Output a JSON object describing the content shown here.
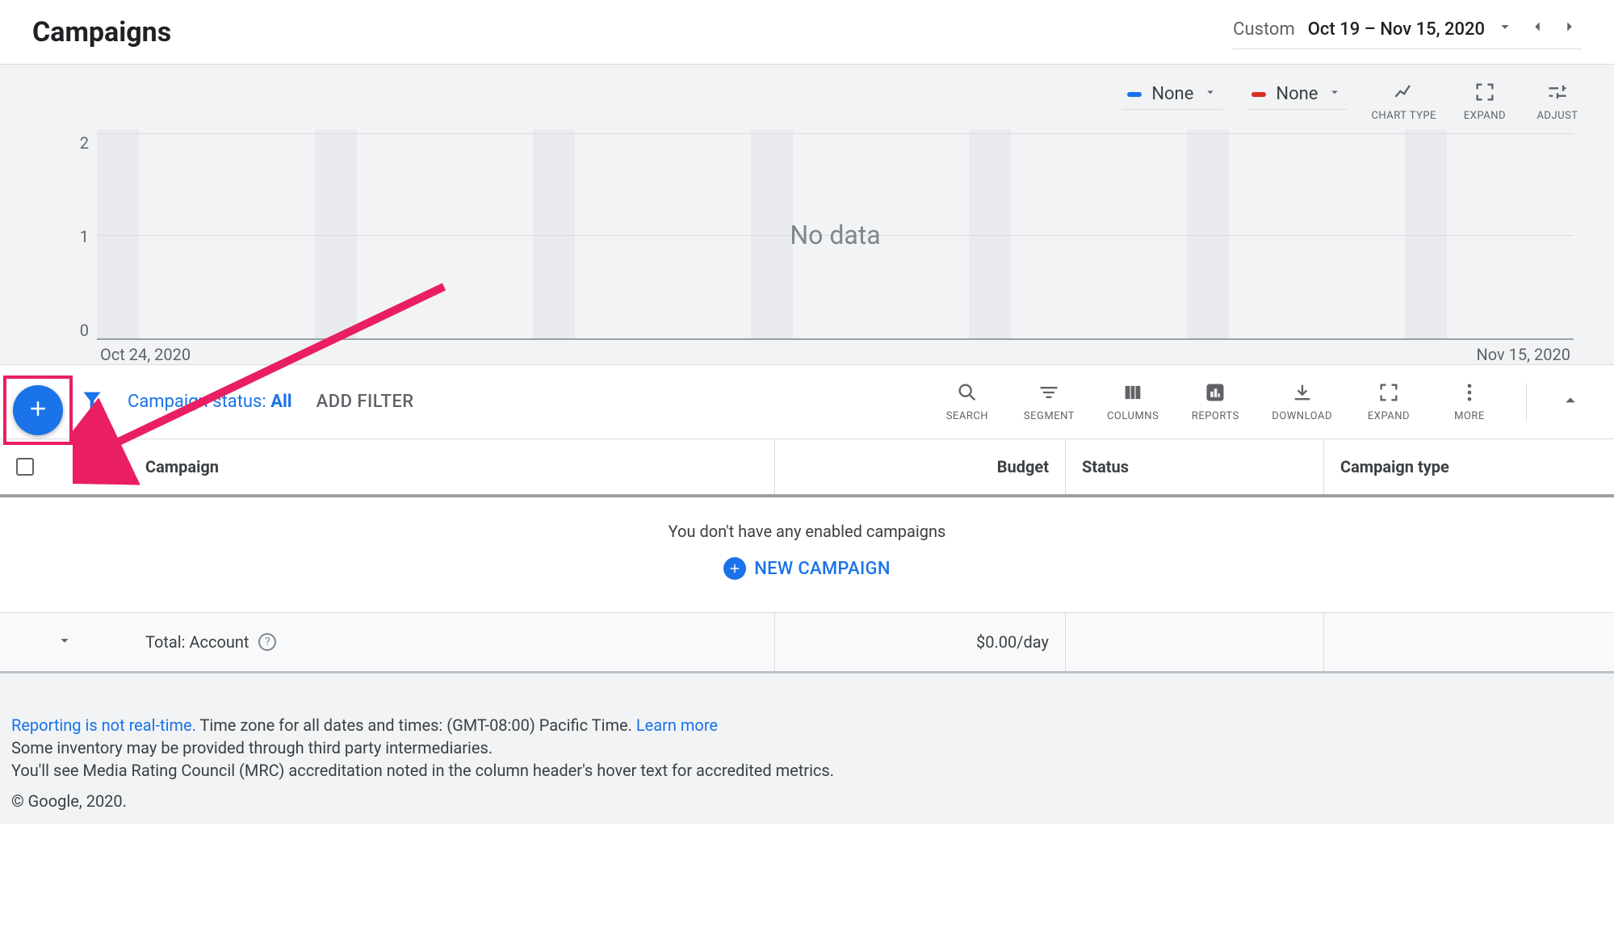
{
  "header": {
    "title": "Campaigns",
    "date_range_prefix": "Custom",
    "date_range_value": "Oct 19 – Nov 15, 2020"
  },
  "chart_toolbar": {
    "metric_a": "None",
    "metric_b": "None",
    "chart_type_label": "CHART TYPE",
    "expand_label": "EXPAND",
    "adjust_label": "ADJUST"
  },
  "chart_data": {
    "type": "line",
    "x": [
      "Oct 24, 2020",
      "Nov 15, 2020"
    ],
    "series": [],
    "ylim": [
      0,
      2
    ],
    "yticks": [
      "2",
      "1",
      "0"
    ],
    "xticks": [
      "Oct 24, 2020",
      "Nov 15, 2020"
    ],
    "no_data_label": "No data"
  },
  "filter_bar": {
    "status_label": "Campaign status: ",
    "status_value": "All",
    "add_filter": "ADD FILTER"
  },
  "table_tools": {
    "search": "SEARCH",
    "segment": "SEGMENT",
    "columns": "COLUMNS",
    "reports": "REPORTS",
    "download": "DOWNLOAD",
    "expand": "EXPAND",
    "more": "MORE"
  },
  "table": {
    "headers": {
      "campaign": "Campaign",
      "budget": "Budget",
      "status": "Status",
      "campaign_type": "Campaign type"
    },
    "empty_text": "You don't have any enabled campaigns",
    "new_campaign_label": "NEW CAMPAIGN",
    "totals": {
      "label": "Total: Account",
      "budget": "$0.00/day"
    }
  },
  "footer": {
    "link1": "Reporting is not real-time.",
    "line1_rest": " Time zone for all dates and times: (GMT-08:00) Pacific Time. ",
    "learn_more": "Learn more",
    "line2": "Some inventory may be provided through third party intermediaries.",
    "line3": "You'll see Media Rating Council (MRC) accreditation noted in the column header's hover text for accredited metrics.",
    "copyright": "© Google, 2020."
  }
}
